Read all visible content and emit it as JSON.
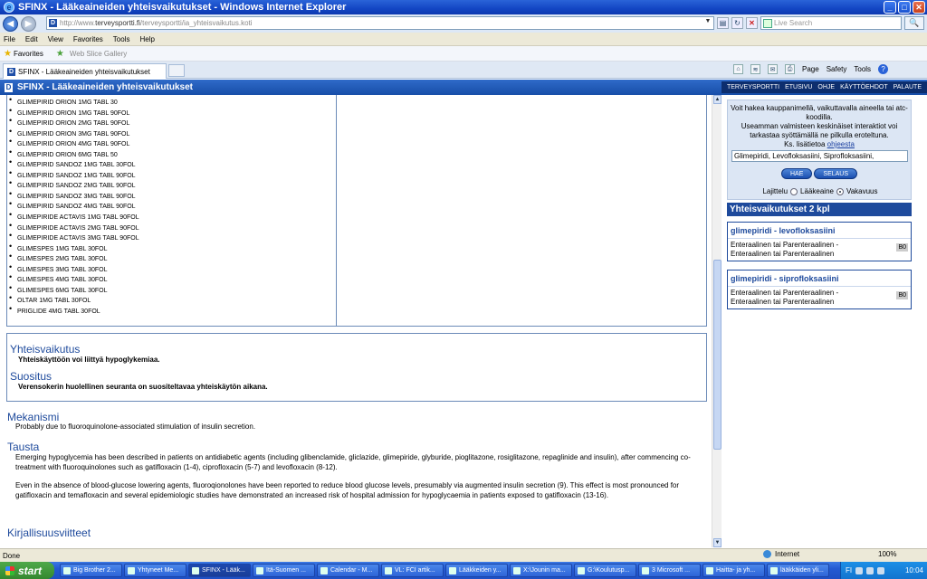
{
  "window": {
    "title": "SFINX - Lääkeaineiden yhteisvaikutukset - Windows Internet Explorer"
  },
  "address": {
    "prefix": "http://www.",
    "domain": "terveysportti.fi",
    "path": "/terveysportti/ia_yhteisvaikutus.koti",
    "live_search_placeholder": "Live Search"
  },
  "menu": [
    "File",
    "Edit",
    "View",
    "Favorites",
    "Tools",
    "Help"
  ],
  "favbar": {
    "favorites": "Favorites",
    "web_slice": "Web Slice Gallery"
  },
  "tab": {
    "label": "SFINX - Lääkeaineiden yhteisvaikutukset"
  },
  "cmdbar": {
    "page": "Page",
    "safety": "Safety",
    "tools": "Tools"
  },
  "banner": {
    "title": "SFINX - Lääkeaineiden yhteisvaikutukset",
    "links": [
      "TERVEYSPORTTI",
      "ETUSIVU",
      "OHJE",
      "KÄYTTÖEHDOT",
      "PALAUTE"
    ]
  },
  "druglist": [
    "GLIMEPIRID ORION 1MG TABL 30",
    "GLIMEPIRID ORION 1MG TABL 90FOL",
    "GLIMEPIRID ORION 2MG TABL 90FOL",
    "GLIMEPIRID ORION 3MG TABL 90FOL",
    "GLIMEPIRID ORION 4MG TABL 90FOL",
    "GLIMEPIRID ORION 6MG TABL 50",
    "GLIMEPIRID SANDOZ 1MG TABL 30FOL",
    "GLIMEPIRID SANDOZ 1MG TABL 90FOL",
    "GLIMEPIRID SANDOZ 2MG TABL 90FOL",
    "GLIMEPIRID SANDOZ 3MG TABL 90FOL",
    "GLIMEPIRID SANDOZ 4MG TABL 90FOL",
    "GLIMEPIRIDE ACTAVIS 1MG TABL 90FOL",
    "GLIMEPIRIDE ACTAVIS 2MG TABL 90FOL",
    "GLIMEPIRIDE ACTAVIS 3MG TABL 90FOL",
    "GLIMESPES 1MG TABL 30FOL",
    "GLIMESPES 2MG TABL 30FOL",
    "GLIMESPES 3MG TABL 30FOL",
    "GLIMESPES 4MG TABL 30FOL",
    "GLIMESPES 6MG TABL 30FOL",
    "OLTAR 1MG TABL 30FOL",
    "PRIGLIDE 4MG TABL 30FOL"
  ],
  "interaction": {
    "yhteisvaikutus_heading": "Yhteisvaikutus",
    "yhteisvaikutus_text": "Yhteiskäyttöön voi liittyä hypoglykemiaa.",
    "suositus_heading": "Suositus",
    "suositus_text": "Verensokerin huolellinen seuranta on suositeltavaa yhteiskäytön aikana."
  },
  "mekanismi": {
    "heading": "Mekanismi",
    "text": "Probably due to fluoroquinolone-associated stimulation of insulin secretion."
  },
  "tausta": {
    "heading": "Tausta",
    "p1": "Emerging hypoglycemia has been described in patients on antidiabetic agents (including glibenclamide, gliclazide, glimepiride, glyburide, pioglitazone, rosiglitazone, repaglinide and insulin), after commencing co-treatment with fluoroquinolones such as gatifloxacin (1-4), ciprofloxacin (5-7) and levofloxacin (8-12).",
    "p2": "Even in the absence of blood-glucose lowering agents, fluoroqionolones have been reported to reduce blood glucose levels, presumably via augmented insulin secretion (9). This effect is most pronounced for gatifloxacin and temafloxacin and several epidemiologic studies have demonstrated an increased risk of hospital admission for hypoglycaemia in patients exposed to gatifloxacin (13-16)."
  },
  "kirjallisuus": {
    "heading": "Kirjallisuusviitteet"
  },
  "search": {
    "line1": "Voit hakea kauppanimellä, vaikuttavalla aineella tai atc-koodilla.",
    "line2": "Useamman valmisteen keskinäiset interaktiot voi tarkastaa syöttämällä ne pilkulla eroteltuna.",
    "line3_prefix": "Ks. lisätietoa",
    "help_link": "ohjeesta",
    "input_value": "Glimepiridi, Levofloksasiini, Siprofloksasiini,",
    "hae_button": "HAE",
    "selaus_button": "SELAUS",
    "sort_label": "Lajittelu",
    "sort_option1": "Lääkeaine",
    "sort_option2": "Vakavuus",
    "sort_selected": "Vakavuus"
  },
  "results": {
    "heading": "Yhteisvaikutukset 2 kpl",
    "items": [
      {
        "title": "glimepiridi - levofloksasiini",
        "route1": "Enteraalinen tai Parenteraalinen -",
        "route2": "Enteraalinen tai Parenteraalinen",
        "class": "B0"
      },
      {
        "title": "glimepiridi - siprofloksasiini",
        "route1": "Enteraalinen tai Parenteraalinen -",
        "route2": "Enteraalinen tai Parenteraalinen",
        "class": "B0"
      }
    ]
  },
  "status": {
    "left": "Done",
    "zone": "Internet",
    "zoom": "100%"
  },
  "taskbar": {
    "start": "start",
    "tasks": [
      "Big Brother 2...",
      "Yhtyneet Me...",
      "SFINX - Lääk...",
      "Itä-Suomen ...",
      "Calendar - M...",
      "VL: FCI artik...",
      "Lääkkeiden y...",
      "X:\\Jounin ma...",
      "G:\\Koulutusp...",
      "3 Microsoft ...",
      "Haitta- ja yh...",
      "lääkkäiden yli..."
    ],
    "lang": "FI",
    "clock": "10:04"
  }
}
